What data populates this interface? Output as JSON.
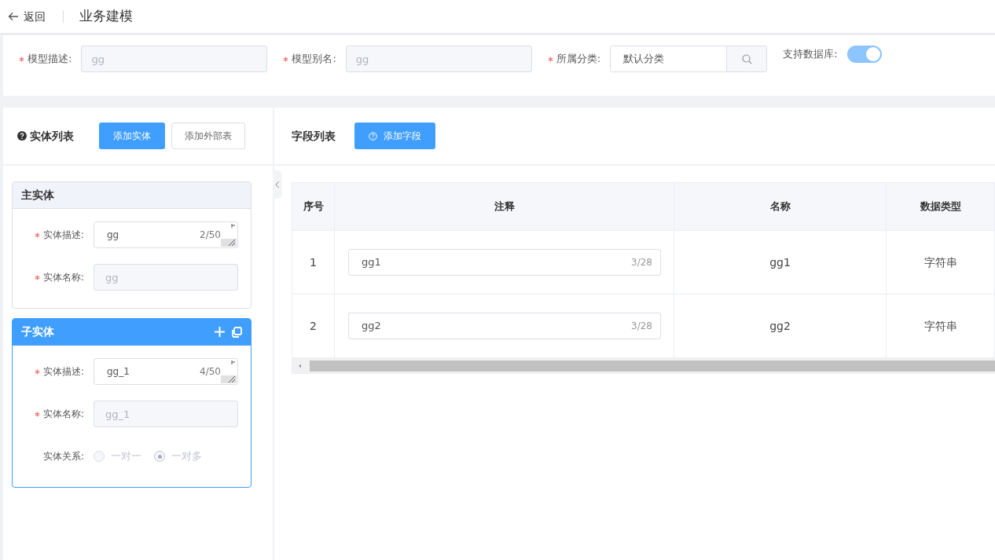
{
  "header": {
    "back": "返回",
    "title": "业务建模"
  },
  "form": {
    "fields": [
      {
        "kind": "input",
        "label": "模型描述:",
        "required": true,
        "value": "gg",
        "disabled": true
      },
      {
        "kind": "input",
        "label": "模型别名:",
        "required": true,
        "value": "gg",
        "disabled": true
      },
      {
        "kind": "search",
        "label": "所属分类:",
        "required": true,
        "value": "默认分类",
        "disabled": false
      },
      {
        "kind": "switch",
        "label": "支持数据库:",
        "required": false,
        "on": true
      }
    ]
  },
  "entity_panel": {
    "title": "实体列表",
    "buttons": [
      {
        "label": "添加实体",
        "kind": "primary"
      },
      {
        "label": "添加外部表",
        "kind": "default"
      }
    ],
    "entities": [
      {
        "title": "主实体",
        "selected": false,
        "fields": [
          {
            "kind": "textarea",
            "label": "实体描述:",
            "required": true,
            "value": "gg",
            "count": "2/50"
          },
          {
            "kind": "input",
            "label": "实体名称:",
            "required": true,
            "value": "gg",
            "disabled": true
          }
        ]
      },
      {
        "title": "子实体",
        "selected": true,
        "fields": [
          {
            "kind": "textarea",
            "label": "实体描述:",
            "required": true,
            "value": "gg_1",
            "count": "4/50"
          },
          {
            "kind": "input",
            "label": "实体名称:",
            "required": true,
            "value": "gg_1",
            "disabled": true
          },
          {
            "kind": "radio",
            "label": "实体关系:",
            "required": false,
            "options": [
              {
                "label": "一对一",
                "selected": false
              },
              {
                "label": "一对多",
                "selected": true
              }
            ]
          }
        ]
      }
    ]
  },
  "field_panel": {
    "title": "字段列表",
    "add_button": "添加字段",
    "table": {
      "columns": [
        "序号",
        "注释",
        "名称",
        "数据类型"
      ],
      "rows": [
        {
          "index": "1",
          "comment": "gg1",
          "count": "3/28",
          "name": "gg1",
          "type": "字符串"
        },
        {
          "index": "2",
          "comment": "gg2",
          "count": "3/28",
          "name": "gg2",
          "type": "字符串"
        }
      ]
    }
  }
}
